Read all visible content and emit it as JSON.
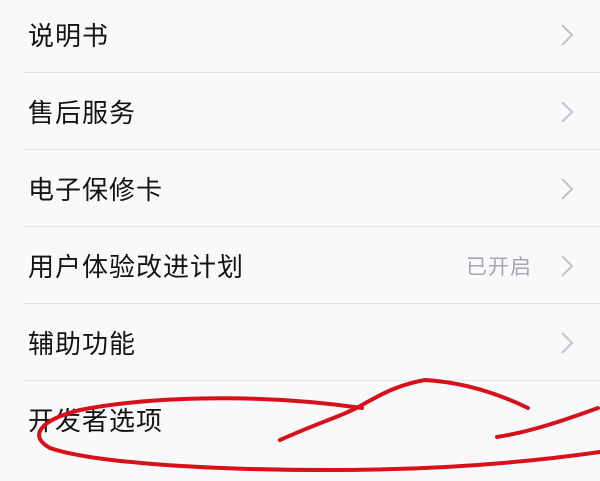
{
  "settings": {
    "items": [
      {
        "label": "说明书",
        "status": ""
      },
      {
        "label": "售后服务",
        "status": ""
      },
      {
        "label": "电子保修卡",
        "status": ""
      },
      {
        "label": "用户体验改进计划",
        "status": "已开启"
      },
      {
        "label": "辅助功能",
        "status": ""
      },
      {
        "label": "开发者选项",
        "status": ""
      }
    ]
  },
  "icons": {
    "row_arrow": "chevron-right-icon",
    "annotation": "red-hand-drawn-circle"
  },
  "colors": {
    "background": "#f9f8fb",
    "label_text": "#141414",
    "status_text": "#a6a6ab",
    "chevron": "#c4c4c8",
    "annotation": "#d8101a"
  }
}
